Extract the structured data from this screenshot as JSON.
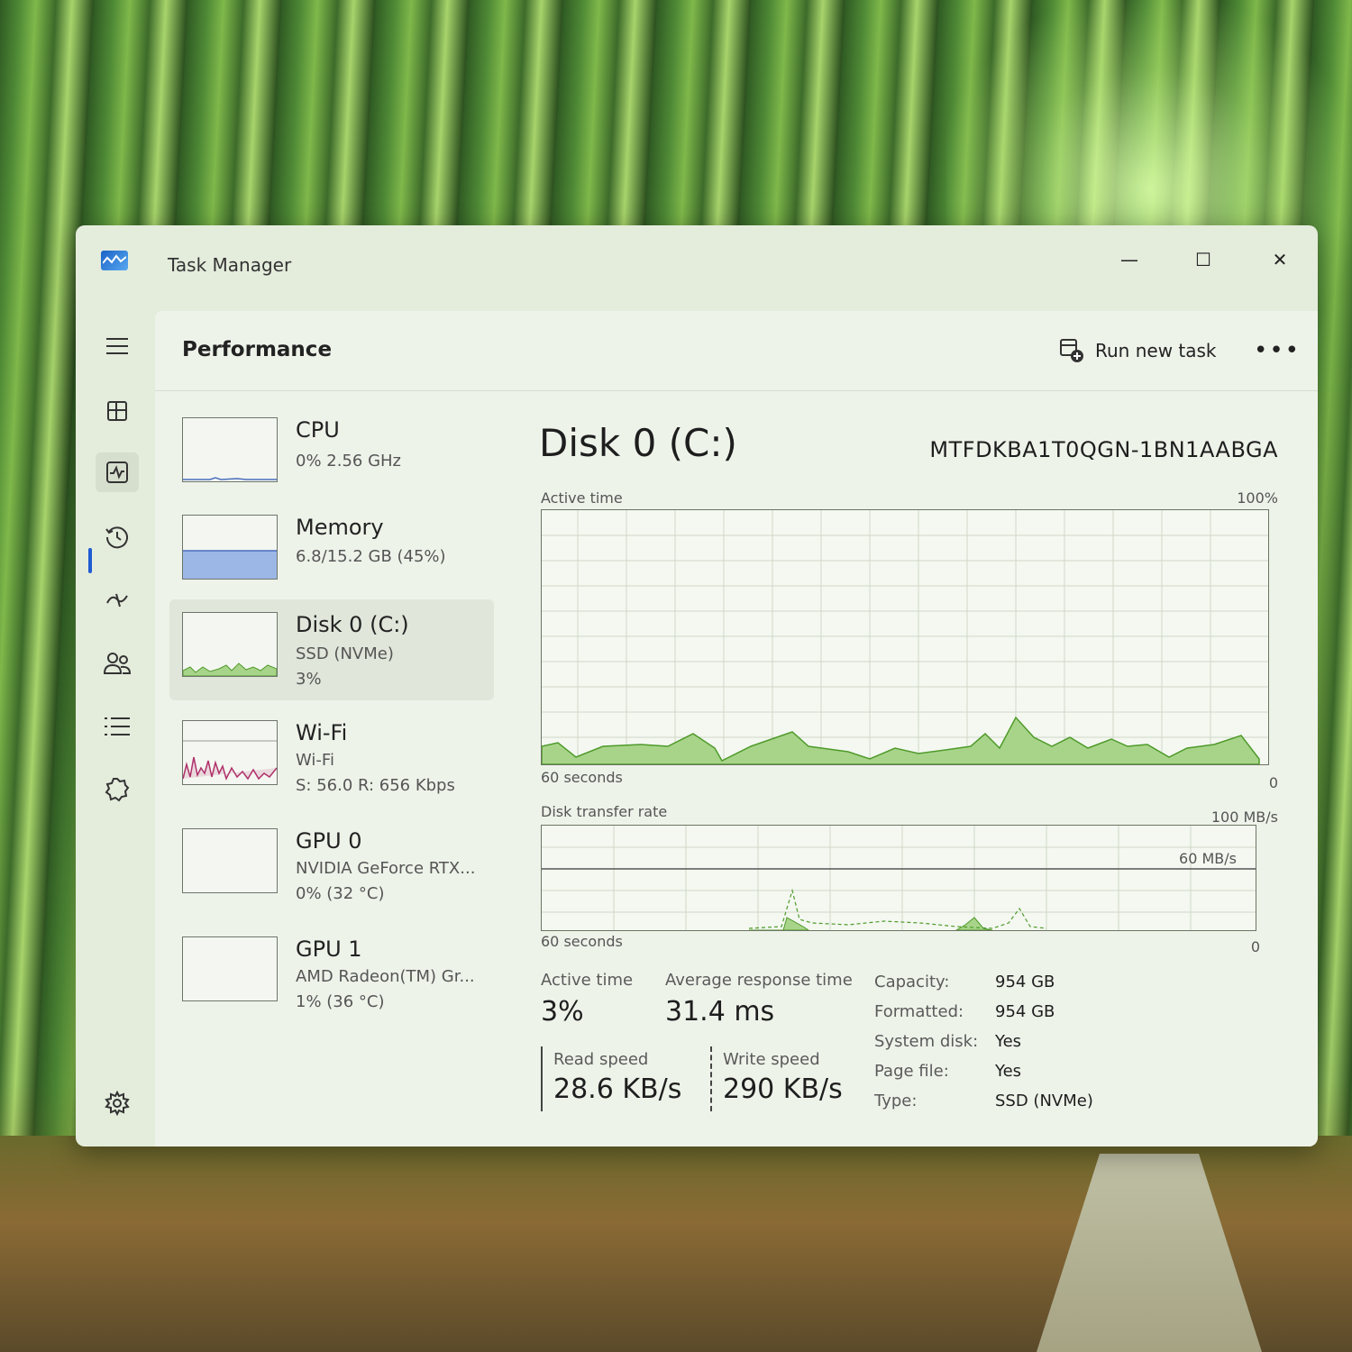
{
  "window": {
    "title": "Task Manager",
    "minimize_glyph": "—",
    "maximize_glyph": "☐",
    "close_glyph": "✕"
  },
  "nav": {
    "icons": [
      "hamburger-icon",
      "processes-icon",
      "performance-icon",
      "app-history-icon",
      "startup-apps-icon",
      "users-icon",
      "details-icon",
      "services-icon",
      "settings-icon"
    ],
    "active": "performance-icon"
  },
  "header": {
    "page_title": "Performance",
    "run_new_task_label": "Run new task",
    "more_label": "•••"
  },
  "devices": [
    {
      "name": "CPU",
      "line1": "0%  2.56 GHz",
      "line2": ""
    },
    {
      "name": "Memory",
      "line1": "6.8/15.2 GB (45%)",
      "line2": "",
      "usage": 0.45
    },
    {
      "name": "Disk 0 (C:)",
      "line1": "SSD (NVMe)",
      "line2": "3%",
      "selected": true
    },
    {
      "name": "Wi-Fi",
      "line1": "Wi-Fi",
      "line2": "S: 56.0  R: 656 Kbps"
    },
    {
      "name": "GPU 0",
      "line1": "NVIDIA GeForce RTX...",
      "line2": "0%  (32 °C)"
    },
    {
      "name": "GPU 1",
      "line1": "AMD Radeon(TM) Gr...",
      "line2": "1%  (36 °C)"
    }
  ],
  "detail": {
    "title": "Disk 0 (C:)",
    "model": "MTFDKBA1T0QGN-1BN1AABGA",
    "active_graph": {
      "label": "Active time",
      "max_label": "100%",
      "time_label": "60 seconds",
      "min_label": "0"
    },
    "transfer_graph": {
      "label": "Disk transfer rate",
      "max_label": "100 MB/s",
      "mid_label": "60 MB/s",
      "time_label": "60 seconds",
      "min_label": "0"
    },
    "stats": {
      "active_time_label": "Active time",
      "active_time_value": "3%",
      "avg_response_label": "Average response time",
      "avg_response_value": "31.4 ms",
      "read_label": "Read speed",
      "read_value": "28.6 KB/s",
      "write_label": "Write speed",
      "write_value": "290 KB/s"
    },
    "properties": [
      {
        "label": "Capacity:",
        "value": "954 GB"
      },
      {
        "label": "Formatted:",
        "value": "954 GB"
      },
      {
        "label": "System disk:",
        "value": "Yes"
      },
      {
        "label": "Page file:",
        "value": "Yes"
      },
      {
        "label": "Type:",
        "value": "SSD (NVMe)"
      }
    ]
  },
  "colors": {
    "disk_line": "#4f9a2a",
    "disk_fill": "#a8d48a",
    "memory_fill": "#9cb7e6",
    "memory_line": "#4a6fbf",
    "wifi_line": "#b0306a",
    "accent": "#1f5bd1"
  }
}
